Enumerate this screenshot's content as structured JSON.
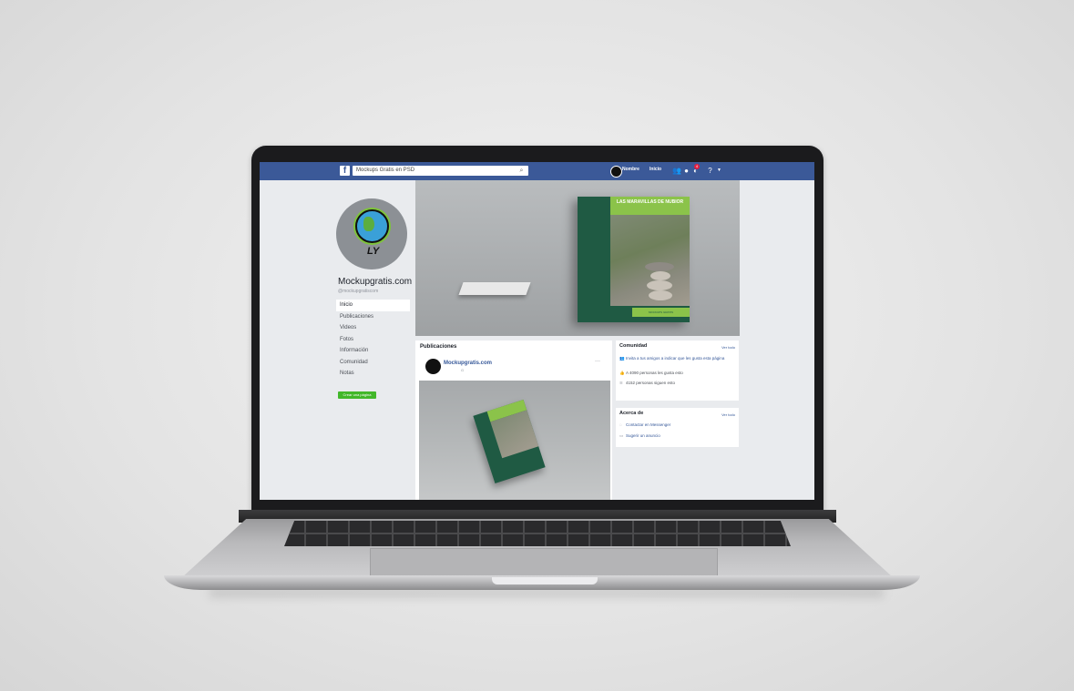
{
  "topbar": {
    "search_text": "Mockups Gratis en PSD",
    "user_name": "Nombre",
    "home_label": "Inicio",
    "notifications_count": "4"
  },
  "profile": {
    "name": "Mockupgratis.com",
    "handle": "@mockupgratiscom",
    "logo_text": "LY"
  },
  "sidebar": {
    "items": [
      {
        "label": "Inicio"
      },
      {
        "label": "Publicaciones"
      },
      {
        "label": "Videos"
      },
      {
        "label": "Fotos"
      },
      {
        "label": "Información"
      },
      {
        "label": "Comunidad"
      },
      {
        "label": "Notas"
      }
    ],
    "cta_label": "Crear una página"
  },
  "cover": {
    "book_title": "LAS MARAVILLAS DE NUBIOR",
    "book_footer": "MOCKUPS GRATIS"
  },
  "posts": {
    "section_title": "Publicaciones",
    "author": "Mockupgratis.com",
    "meta": "G",
    "more": "···"
  },
  "community": {
    "title": "Comunidad",
    "see_all": "Ver todo",
    "rows": [
      {
        "icon": "invite-icon",
        "text": "Invita a tus amigos a indicar que les gusta esta página"
      },
      {
        "icon": "like-icon",
        "text": "A 4090 personas les gusta esto"
      },
      {
        "icon": "follow-icon",
        "text": "4152 personas siguen esto"
      }
    ]
  },
  "about": {
    "title": "Acerca de",
    "see_all": "Ver todo",
    "rows": [
      {
        "icon": "messenger-icon",
        "text": "Contactar en Messenger"
      },
      {
        "icon": "suggest-icon",
        "text": "Sugerir un anuncio"
      }
    ]
  },
  "colors": {
    "facebook_blue": "#3b5998",
    "brand_green": "#8bc34a",
    "book_green": "#1f5a43",
    "cta_green": "#42b72a"
  }
}
